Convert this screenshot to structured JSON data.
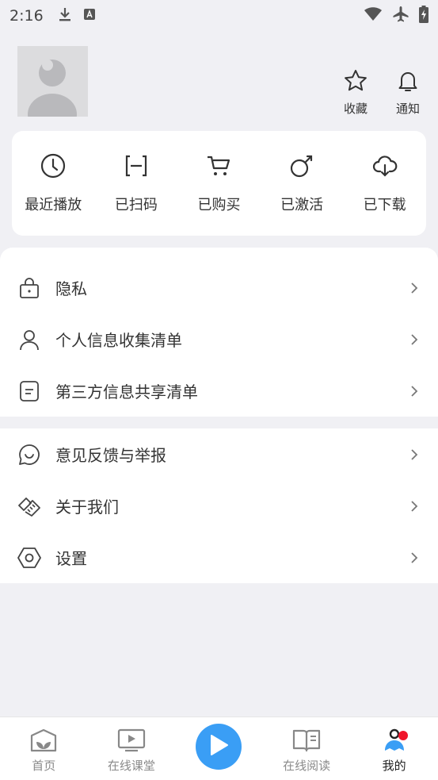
{
  "status": {
    "time": "2:16"
  },
  "header": {
    "favorites_label": "收藏",
    "notifications_label": "通知"
  },
  "quick": [
    {
      "label": "最近播放",
      "icon": "clock-icon"
    },
    {
      "label": "已扫码",
      "icon": "scan-icon"
    },
    {
      "label": "已购买",
      "icon": "cart-icon"
    },
    {
      "label": "已激活",
      "icon": "activate-icon"
    },
    {
      "label": "已下载",
      "icon": "cloud-download-icon"
    }
  ],
  "menu1": [
    {
      "label": "隐私",
      "icon": "lock-icon"
    },
    {
      "label": "个人信息收集清单",
      "icon": "person-icon"
    },
    {
      "label": "第三方信息共享清单",
      "icon": "document-icon"
    }
  ],
  "menu2": [
    {
      "label": "意见反馈与举报",
      "icon": "chat-smile-icon"
    },
    {
      "label": "关于我们",
      "icon": "handshake-icon"
    },
    {
      "label": "设置",
      "icon": "hexagon-settings-icon"
    }
  ],
  "nav": {
    "home": "首页",
    "classroom": "在线课堂",
    "reading": "在线阅读",
    "mine": "我的"
  },
  "colors": {
    "accent": "#3a9ef5",
    "badge": "#f0152b",
    "background": "#f0f0f4"
  }
}
